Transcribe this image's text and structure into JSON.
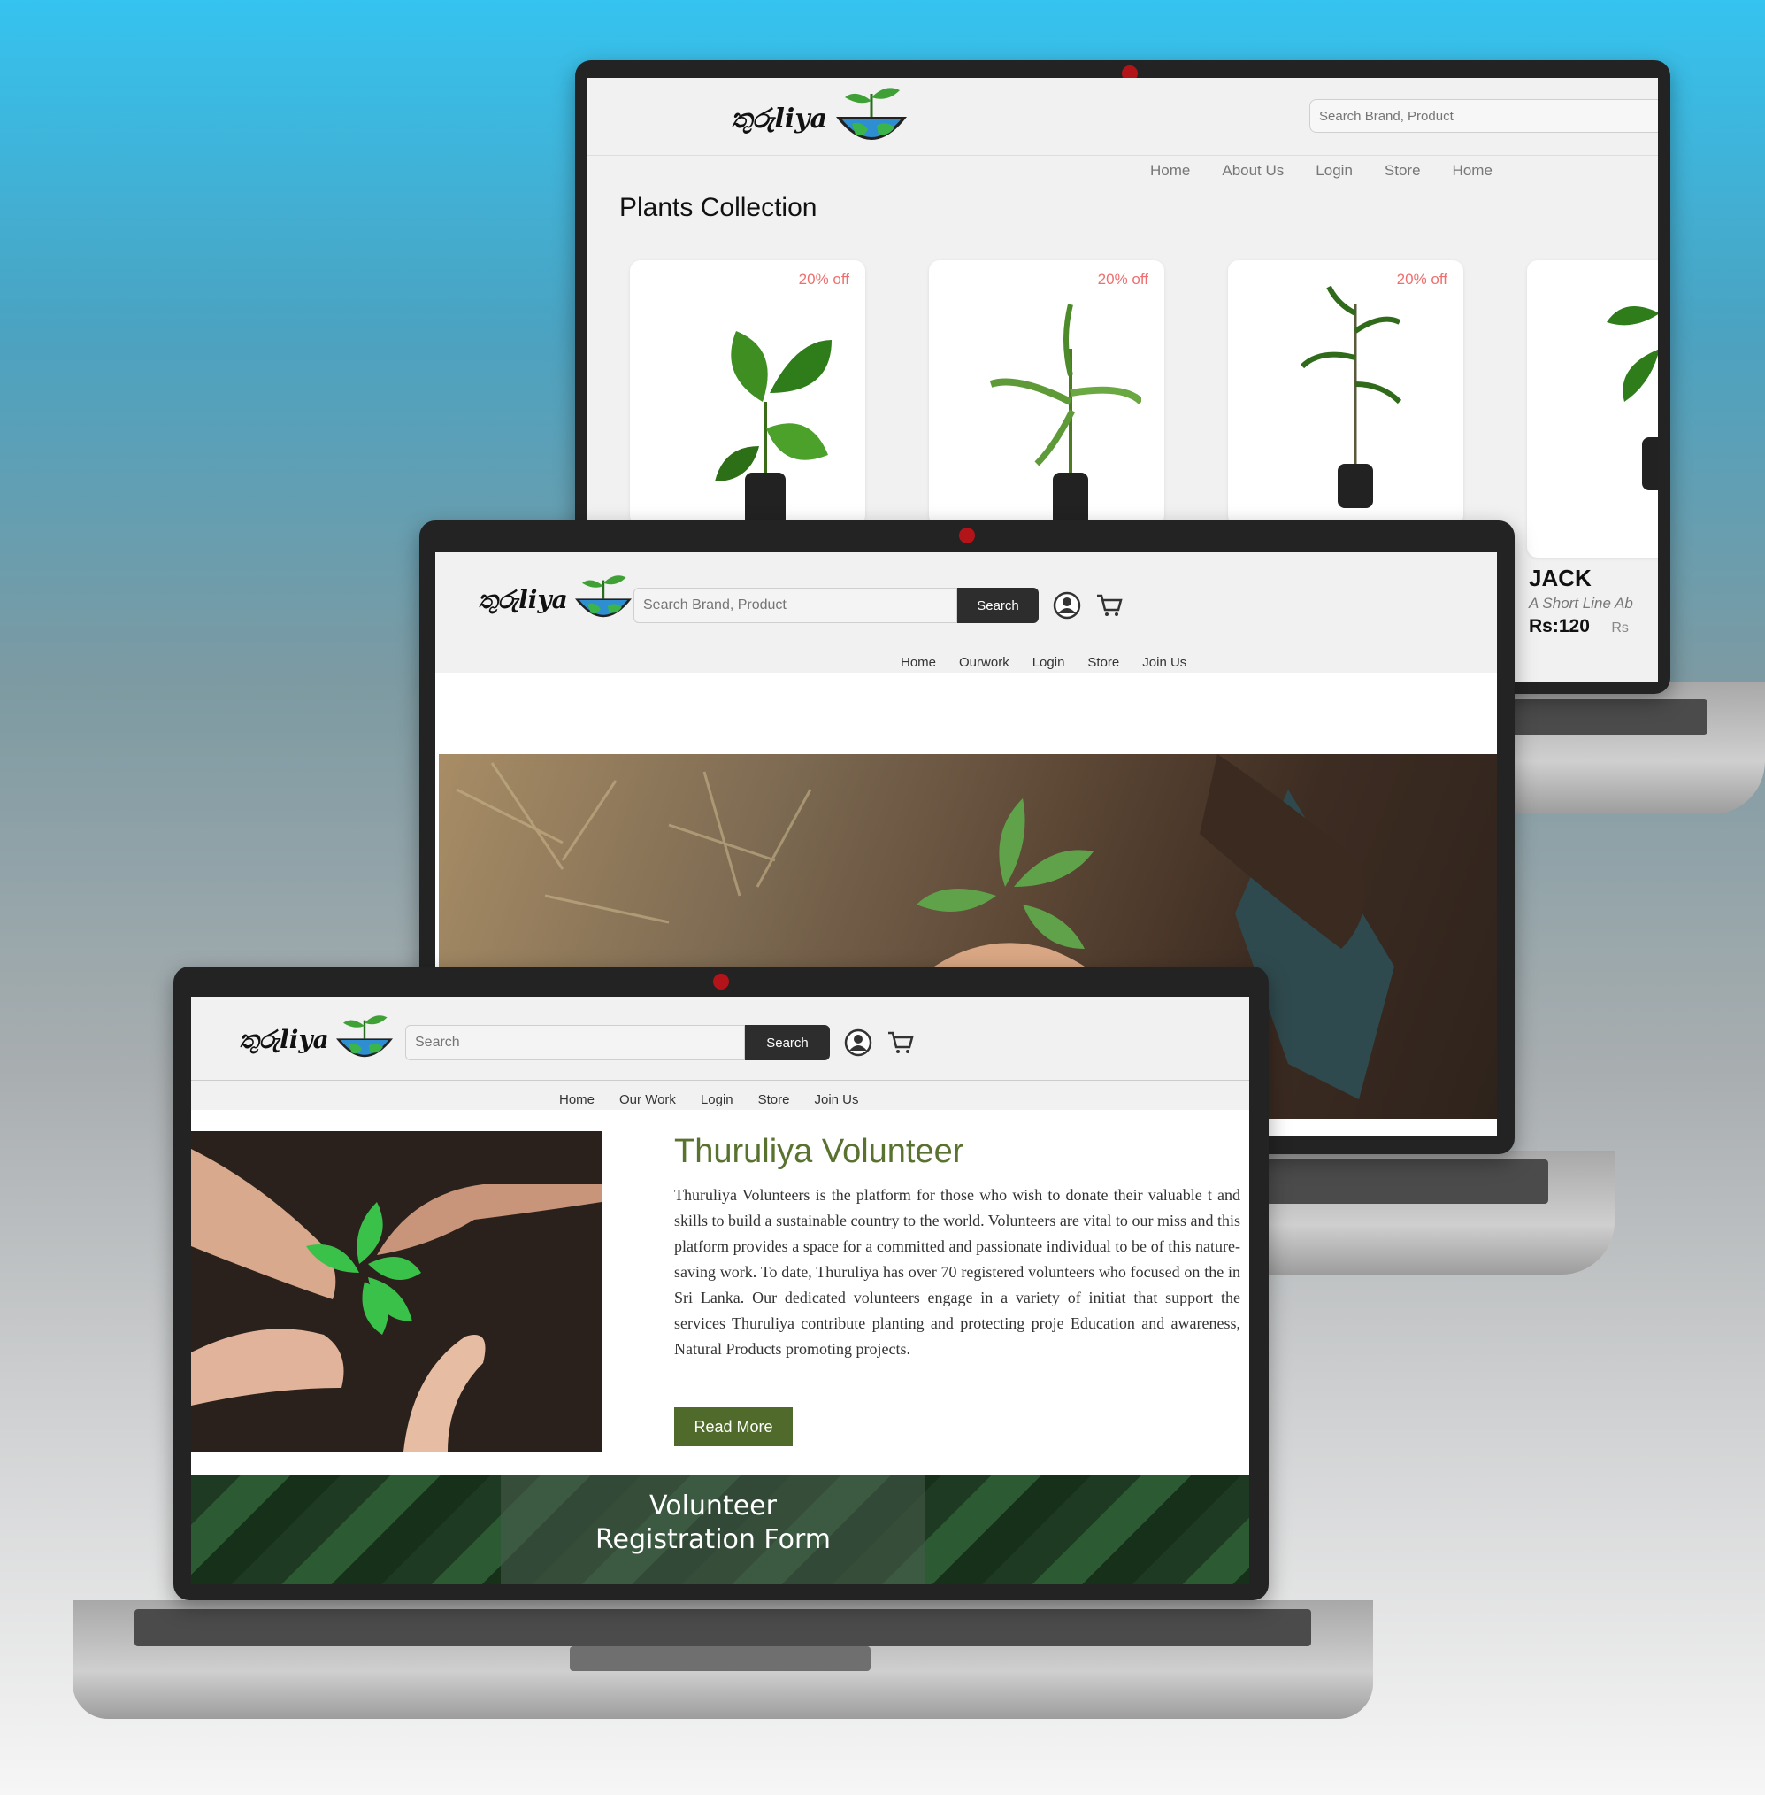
{
  "brand": {
    "logo_text": "තුරුliya"
  },
  "back_screen": {
    "search_placeholder": "Search Brand, Product",
    "nav": [
      "Home",
      "About Us",
      "Login",
      "Store",
      "Home"
    ],
    "heading": "Plants Collection",
    "cards": [
      {
        "badge": "20% off"
      },
      {
        "badge": "20% off"
      },
      {
        "badge": "20% off"
      }
    ],
    "product": {
      "name": "JACK",
      "desc": "A Short Line Ab",
      "price": "Rs:120",
      "old_price": "Rs"
    }
  },
  "mid_screen": {
    "search_placeholder": "Search Brand, Product",
    "search_button": "Search",
    "nav": [
      "Home",
      "Ourwork",
      "Login",
      "Store",
      "Join Us"
    ]
  },
  "front_screen": {
    "search_placeholder": "Search",
    "search_button": "Search",
    "nav": [
      "Home",
      "Our Work",
      "Login",
      "Store",
      "Join Us"
    ],
    "title": "Thuruliya Volunteer",
    "body": "Thuruliya Volunteers is the platform for those who wish to donate their valuable t and skills to build a sustainable country to the world. Volunteers are vital to our miss and this platform provides a space for a committed and passionate individual to be of this nature-saving work. To date, Thuruliya has over 70 registered volunteers who focused on the in Sri Lanka. Our dedicated volunteers engage in a variety of initiat that support the services Thuruliya contribute planting and protecting proje Education and awareness, Natural Products promoting projects.",
    "read_more": "Read More",
    "banner_line1": "Volunteer",
    "banner_line2": "Registration Form"
  },
  "colors": {
    "accent_green": "#4f6a2a",
    "title_green": "#5a7230",
    "badge_red": "#ef6f6f",
    "bezel": "#232323"
  },
  "icons": [
    "user-icon",
    "cart-icon",
    "logo-plant-globe-icon"
  ]
}
